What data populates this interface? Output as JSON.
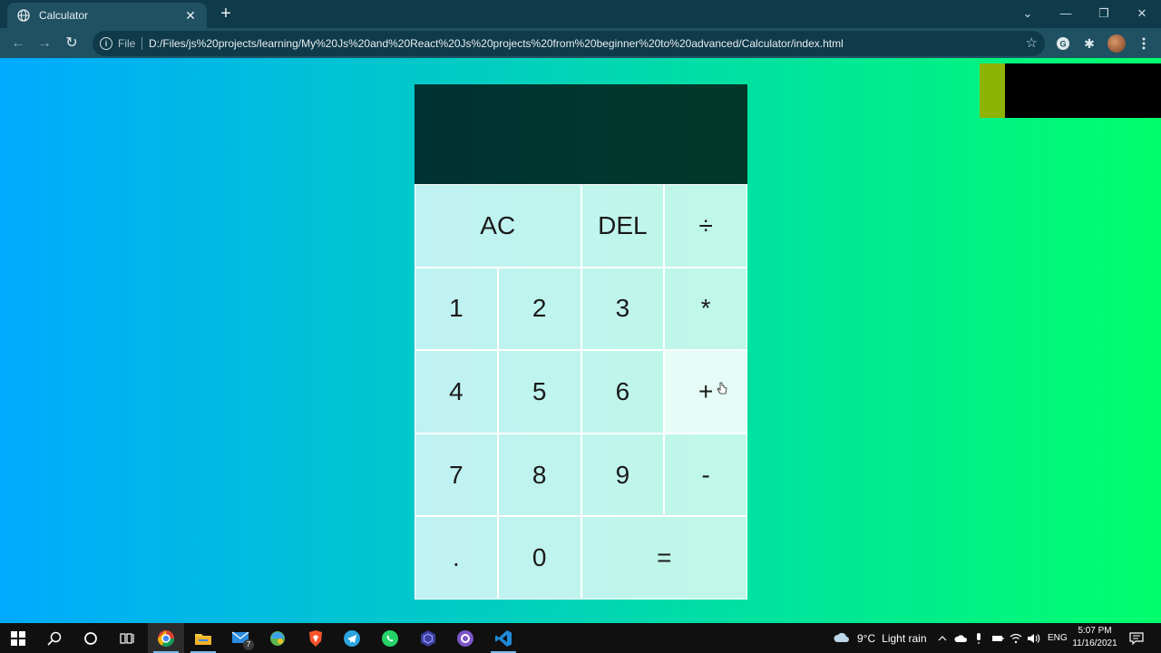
{
  "browser": {
    "tab_title": "Calculator",
    "close_glyph": "✕",
    "new_tab_glyph": "+",
    "scheme": "File",
    "url": "D:/Files/js%20projects/learning/My%20Js%20and%20React%20Js%20projects%20from%20beginner%20to%20advanced/Calculator/index.html",
    "nav": {
      "back": "←",
      "forward": "→",
      "reload": "↻"
    },
    "window": {
      "tab_search": "⌄",
      "minimize": "—",
      "restore": "❐",
      "close": "✕"
    },
    "star_glyph": "☆",
    "extension_glyph": "✱"
  },
  "calculator": {
    "previous_operand": "",
    "current_operand": "",
    "keys": {
      "ac": "AC",
      "del": "DEL",
      "divide": "÷",
      "one": "1",
      "two": "2",
      "three": "3",
      "multiply": "*",
      "four": "4",
      "five": "5",
      "six": "6",
      "plus": "+",
      "seven": "7",
      "eight": "8",
      "nine": "9",
      "minus": "-",
      "dot": ".",
      "zero": "0",
      "equals": "="
    },
    "hovered_key": "plus"
  },
  "taskbar": {
    "weather_temp": "9°C",
    "weather_text": "Light rain",
    "language": "ENG",
    "time": "5:07 PM",
    "date": "11/16/2021",
    "mail_badge": "7"
  },
  "colors": {
    "page_gradient_start": "#00aaff",
    "page_gradient_end": "#00ff6c",
    "display_bg": "#042a26",
    "key_bg": "#c8f0ea"
  }
}
